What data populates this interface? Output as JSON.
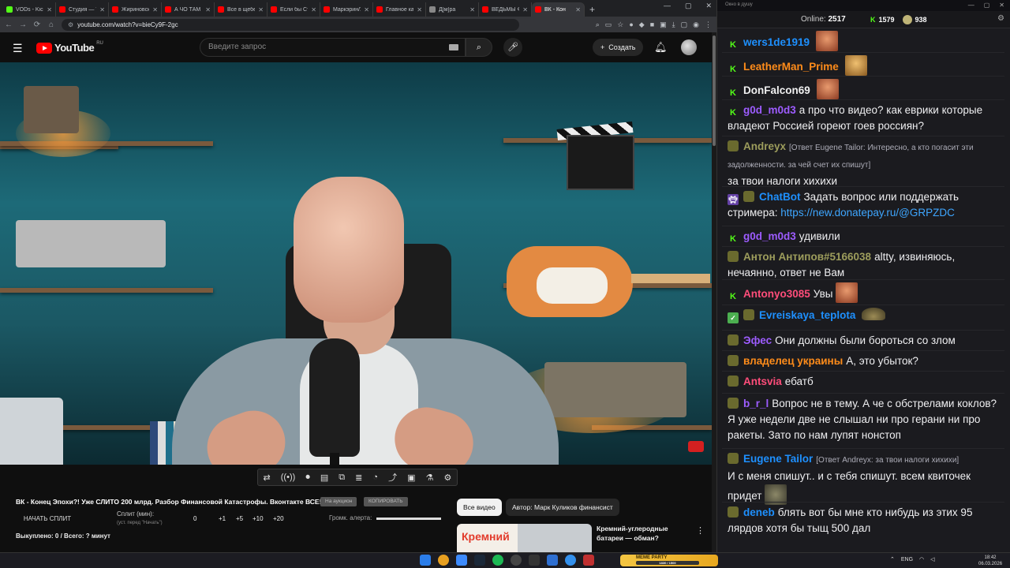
{
  "browser": {
    "tabs": [
      {
        "label": "VODs - Kick",
        "color": "#53fc18",
        "active": false
      },
      {
        "label": "Студия — YouTube",
        "color": "#ff0000",
        "active": false
      },
      {
        "label": "Жириновский",
        "color": "#ff0000",
        "active": false
      },
      {
        "label": "А ЧО ТАМ В",
        "color": "#ff0000",
        "active": false
      },
      {
        "label": "Все в щебенке",
        "color": "#ff0000",
        "active": false
      },
      {
        "label": "Если бы Ста",
        "color": "#ff0000",
        "active": false
      },
      {
        "label": "Маркэрин/У",
        "color": "#ff0000",
        "active": false
      },
      {
        "label": "Главное ка",
        "color": "#ff0000",
        "active": false
      },
      {
        "label": "Д[м]ра",
        "color": "#888888",
        "active": false
      },
      {
        "label": "ВЕДЬМЫ ФИ",
        "color": "#ff0000",
        "active": false
      },
      {
        "label": "ВК - Кон",
        "color": "#ff0000",
        "active": true
      }
    ],
    "url": "youtube.com/watch?v=bieCy9F-2gc"
  },
  "youtube": {
    "logo_text": "YouTube",
    "region": "RU",
    "search_placeholder": "Введите запрос",
    "create_label": "Создать",
    "video_title": "ВК - Конец Эпохи?! Уже СЛИТО 200 млрд. Разбор Финансовой Катастрофы. Вконтакте ВСЕ!",
    "pill_auction": "На аукцион",
    "pill_copy": "КОПИРОВАТЬ",
    "split_button": "НАЧАТЬ СПЛИТ",
    "split_label": "Сплит (мин):",
    "split_hint": "(уст. перед \"Начать\")",
    "split_values": [
      "0",
      "+1",
      "+5",
      "+10",
      "+20"
    ],
    "alert_volume_label": "Громк. алерта:",
    "alert_volume": 1.0,
    "bought": "Выкуплено: 0 / Всего: ? минут",
    "chips": [
      "Все видео",
      "Автор: Марк Куликов финансист"
    ],
    "related": {
      "thumb_text": "Кремний",
      "title": "Кремний-углеродные батареи — обман?"
    }
  },
  "chat": {
    "window_title": "Окно в душу",
    "online_label": "Online:",
    "online_count": "2517",
    "kick_count": "1579",
    "yt_count": "938",
    "messages": [
      {
        "badge": "kick",
        "nick": "wers1de1919",
        "color": "#1e90ff",
        "reply": "",
        "text": "",
        "emote": "face"
      },
      {
        "badge": "kick",
        "nick": "LeatherMan_Prime",
        "color": "#ff8c1a",
        "reply": "",
        "text": "",
        "emote": "gold"
      },
      {
        "badge": "kick",
        "nick": "DonFalcon69",
        "color": "#f0f0f0",
        "reply": "",
        "text": "",
        "emote": "face"
      },
      {
        "badge": "kick",
        "nick": "g0d_m0d3",
        "color": "#9d5cff",
        "reply": "",
        "text": "а про что видео? как еврики которые владеют Россией гореют гоев россиян?",
        "emote": ""
      },
      {
        "badge": "yt",
        "nick": "Andreyx",
        "color": "#9d9d5c",
        "reply": "[Ответ Eugene Tailor: Интересно, а кто погасит эти задолженности. за чей счет их спишут]",
        "text": "за твои налоги хихихи",
        "emote": ""
      },
      {
        "badge": "bot",
        "nick": "ChatBot",
        "color": "#1e90ff",
        "reply": "",
        "text": "Задать вопрос или поддержать стримера: ",
        "link": "https://new.donatepay.ru/@GRPZDC",
        "emote": ""
      },
      {
        "badge": "kick",
        "nick": "g0d_m0d3",
        "color": "#9d5cff",
        "reply": "",
        "text": "удивили",
        "emote": ""
      },
      {
        "badge": "yt",
        "nick": "Антон Антипов#5166038",
        "color": "#9d9d5c",
        "reply": "",
        "text": "altty, извиняюсь, нечаянно, ответ не Вам",
        "emote": ""
      },
      {
        "badge": "kick",
        "nick": "Antonyo3085",
        "color": "#ff4d7a",
        "reply": "",
        "text": "Увы",
        "emote": "face"
      },
      {
        "badge": "check",
        "nick": "Evreiskaya_teplota",
        "color": "#1e90ff",
        "reply": "",
        "text": "",
        "emote": "hat"
      },
      {
        "badge": "yt",
        "nick": "Эфес",
        "color": "#9d5cff",
        "reply": "",
        "text": "Они должны были бороться со злом",
        "emote": ""
      },
      {
        "badge": "yt",
        "nick": "владелец украины",
        "color": "#ff8c1a",
        "reply": "",
        "text": "А, это убыток?",
        "emote": ""
      },
      {
        "badge": "yt",
        "nick": "Antsvia",
        "color": "#ff4d7a",
        "reply": "",
        "text": "ебатб",
        "emote": ""
      },
      {
        "badge": "yt",
        "nick": "b_r_l",
        "color": "#9d5cff",
        "reply": "",
        "text": "Вопрос не в тему. А че с обстрелами коклов? Я уже недели две не слышал ни про герани ни про ракеты. Зато по нам лупят нонстоп",
        "emote": ""
      },
      {
        "badge": "yt",
        "nick": "Eugene Tailor",
        "color": "#1e90ff",
        "reply": "[Ответ Andreyx: за твои налоги хихихи]",
        "text": "И с меня спишут.. и с тебя спишут. всем квиточек придет",
        "emote": "rock"
      },
      {
        "badge": "yt",
        "nick": "deneb",
        "color": "#1e90ff",
        "reply": "",
        "text": "блять вот бы мне кто нибудь из этих 95 лярдов хотя бы тыщ 500 дал",
        "emote": ""
      }
    ]
  },
  "taskbar": {
    "meme_label": "MEME PARTY",
    "meme_bar": "1830 / 1500",
    "lang": "ENG",
    "time": "18:42",
    "date": "06.03.2026"
  }
}
